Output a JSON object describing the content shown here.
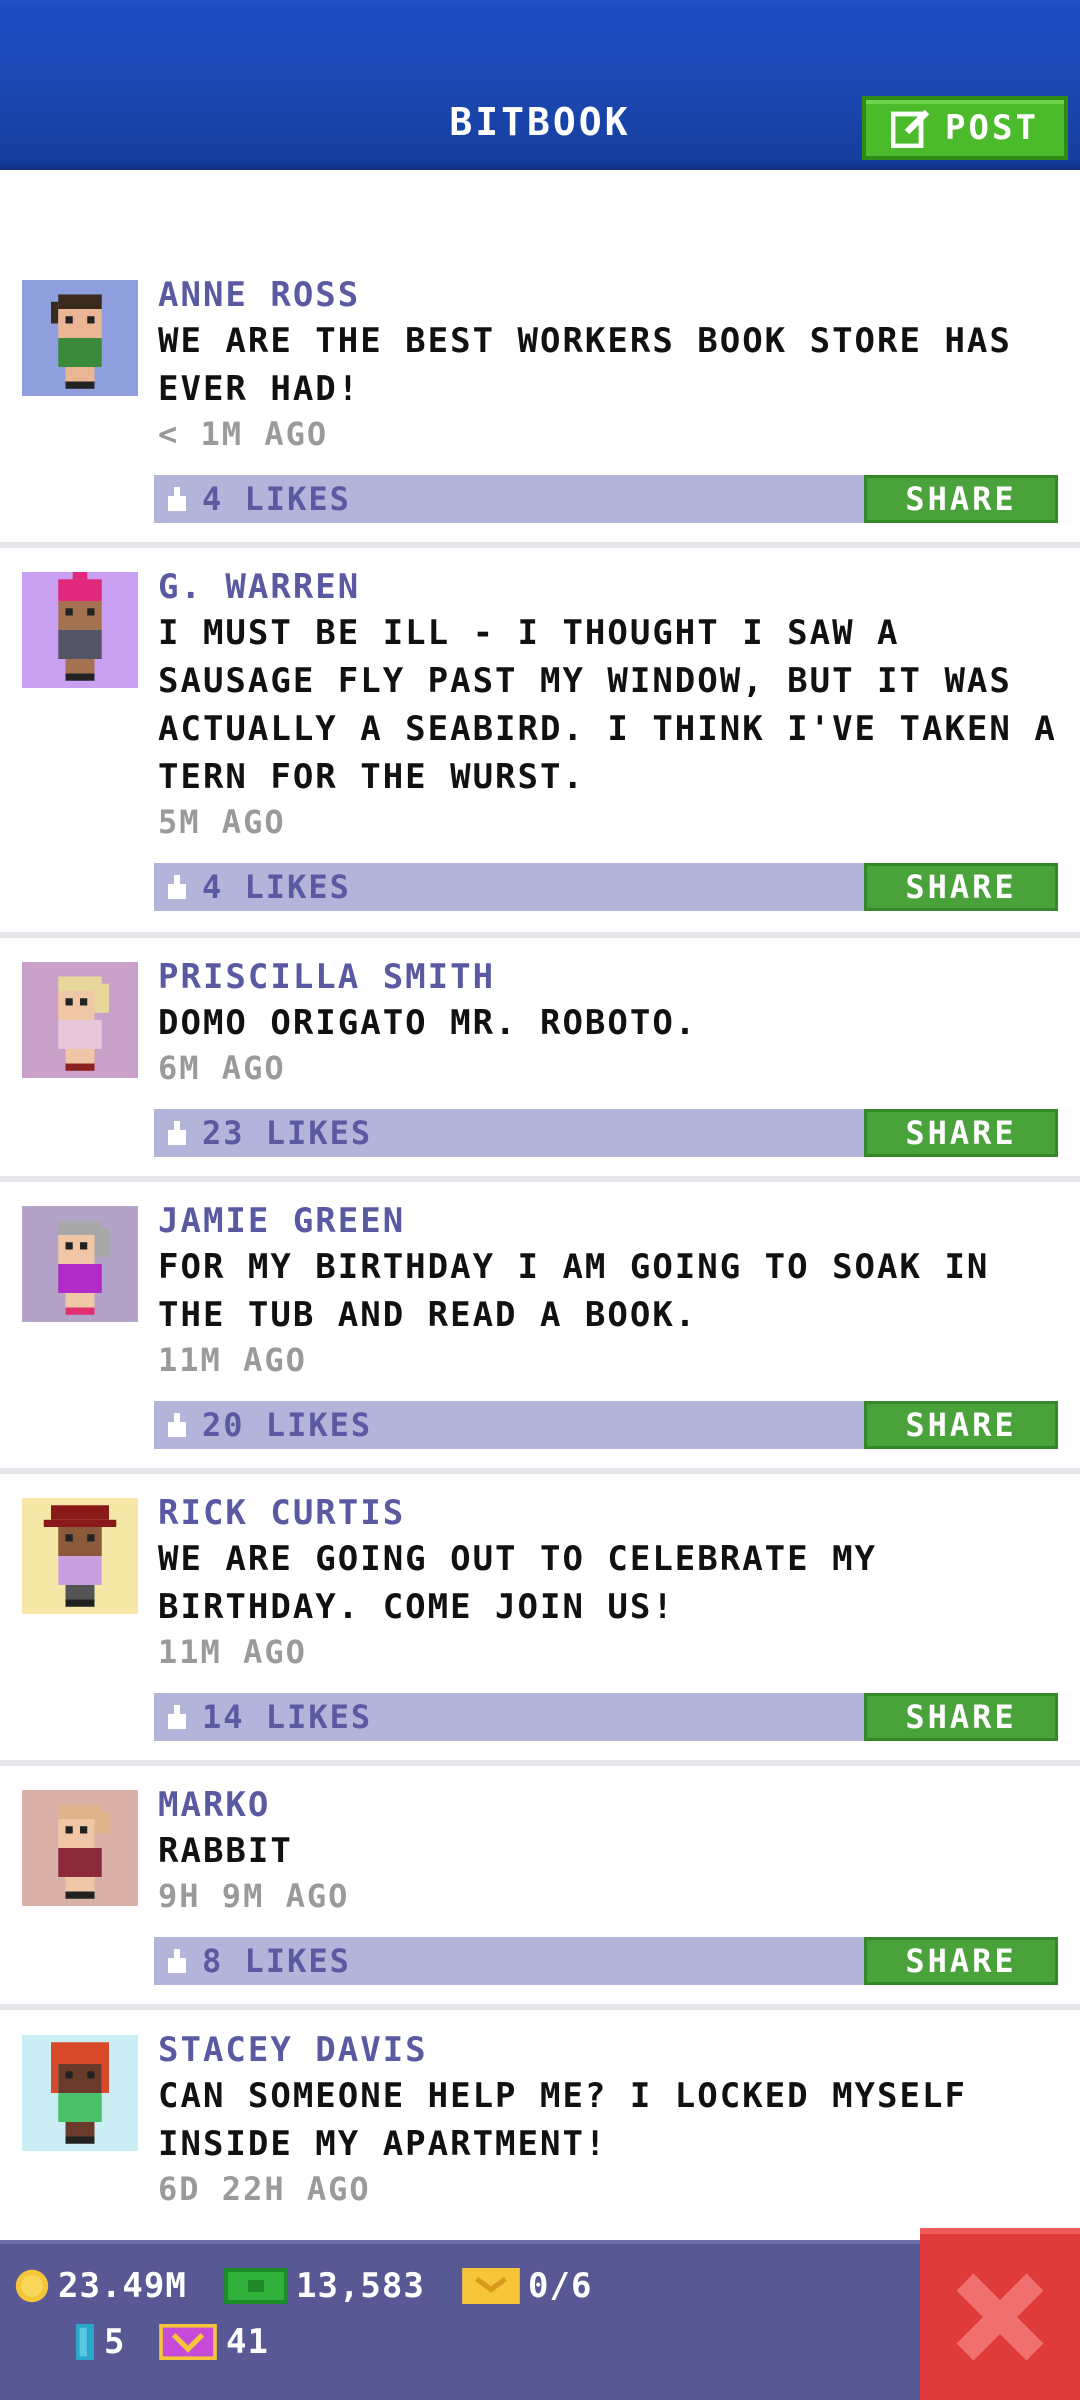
{
  "header": {
    "title": "BITBOOK",
    "post_label": "POST"
  },
  "posts": [
    {
      "name": "ANNE ROSS",
      "message": "WE ARE THE BEST WORKERS BOOK STORE HAS EVER HAD!",
      "time": "< 1M AGO",
      "likes": "4 LIKES",
      "share": "SHARE"
    },
    {
      "name": "G. WARREN",
      "message": "I MUST BE ILL - I THOUGHT I SAW A SAUSAGE FLY PAST MY WINDOW, BUT IT WAS ACTUALLY A SEABIRD. I THINK I'VE TAKEN A TERN FOR THE WURST.",
      "time": "5M AGO",
      "likes": "4 LIKES",
      "share": "SHARE"
    },
    {
      "name": "PRISCILLA SMITH",
      "message": "DOMO ORIGATO MR. ROBOTO.",
      "time": "6M AGO",
      "likes": "23 LIKES",
      "share": "SHARE"
    },
    {
      "name": "JAMIE GREEN",
      "message": "FOR MY BIRTHDAY I AM GOING TO SOAK IN THE TUB AND READ A BOOK.",
      "time": "11M AGO",
      "likes": "20 LIKES",
      "share": "SHARE"
    },
    {
      "name": "RICK CURTIS",
      "message": "WE ARE GOING OUT TO CELEBRATE MY BIRTHDAY. COME JOIN US!",
      "time": "11M AGO",
      "likes": "14 LIKES",
      "share": "SHARE"
    },
    {
      "name": "MARKO",
      "message": "RABBIT",
      "time": "9H 9M AGO",
      "likes": "8 LIKES",
      "share": "SHARE"
    },
    {
      "name": "STACEY DAVIS",
      "message": "CAN SOMEONE HELP ME? I LOCKED MYSELF INSIDE MY APARTMENT!",
      "time": "6D 22H AGO",
      "likes": "",
      "share": ""
    }
  ],
  "stats": {
    "coins": "23.49M",
    "bux": "13,583",
    "tickets": "0/6",
    "keys": "5",
    "vip": "41"
  },
  "colors": {
    "header_blue": "#1b4ab9",
    "share_green": "#4aa23a",
    "like_bar": "#b3b4d9",
    "name_purple": "#5a5aa2",
    "close_red": "#e03b3b"
  }
}
